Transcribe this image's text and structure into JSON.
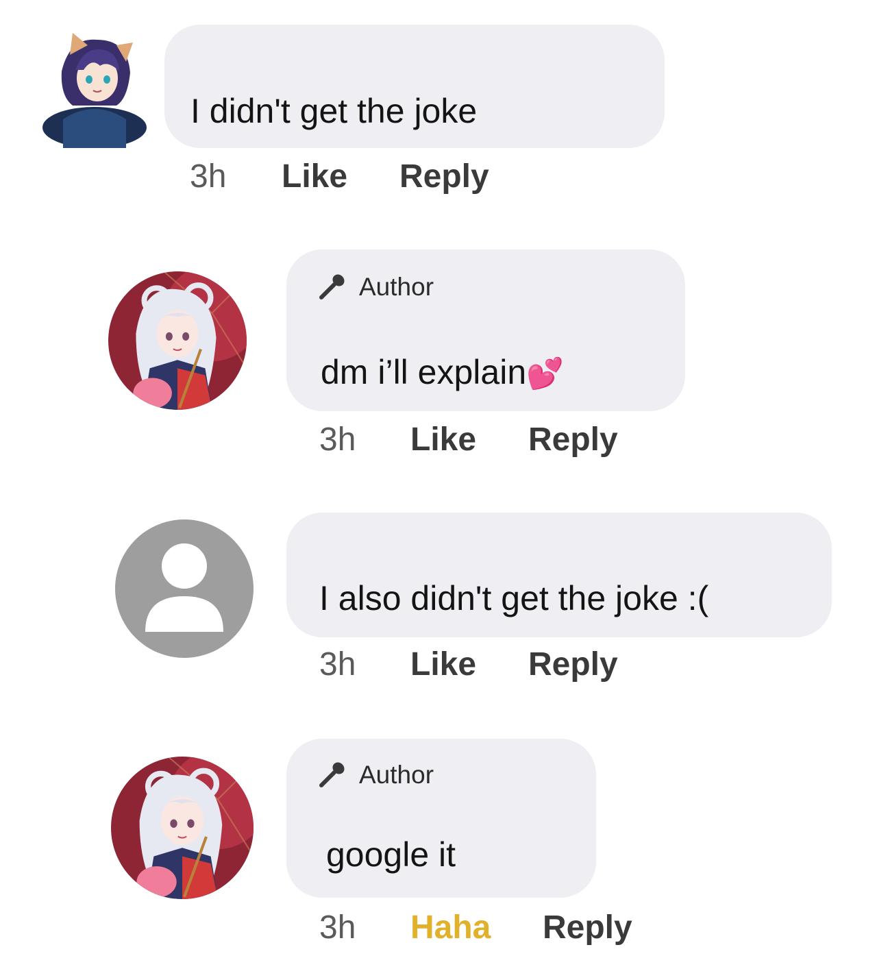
{
  "comments": [
    {
      "text": "I didn't get the joke",
      "time": "3h",
      "like_label": "Like",
      "reply_label": "Reply",
      "avatar_icon": "anime-boy-avatar"
    },
    {
      "badge": "Author",
      "badge_icon": "microphone-icon",
      "text": "dm i’ll explain",
      "emoji": "💕",
      "time": "3h",
      "like_label": "Like",
      "reply_label": "Reply",
      "avatar_icon": "anime-girl-avatar"
    },
    {
      "text": "I also didn't get the joke :(",
      "time": "3h",
      "like_label": "Like",
      "reply_label": "Reply",
      "avatar_icon": "default-user-icon"
    },
    {
      "badge": "Author",
      "badge_icon": "microphone-icon",
      "text": "google it",
      "time": "3h",
      "reaction_label": "Haha",
      "reply_label": "Reply",
      "avatar_icon": "anime-girl-avatar"
    }
  ],
  "colors": {
    "bubble": "#efeff3",
    "haha": "#e1b12c",
    "default_avatar": "#9e9e9e"
  }
}
